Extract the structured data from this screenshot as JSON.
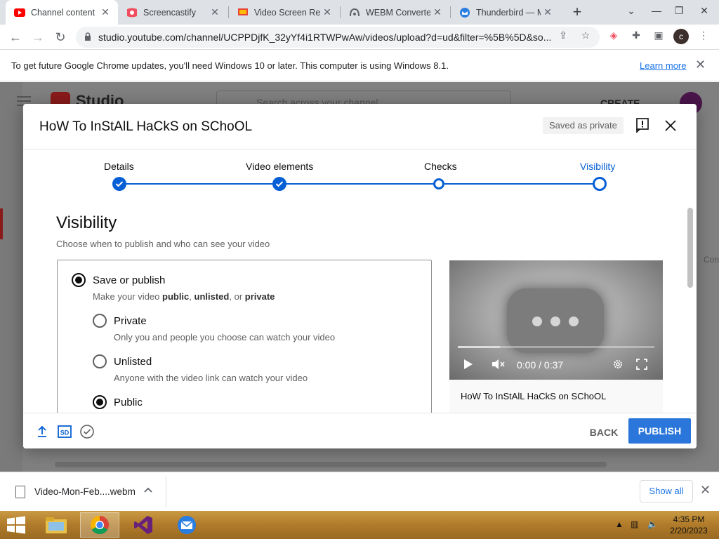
{
  "browser": {
    "tabs": [
      {
        "title": "Channel content",
        "icon": "youtube-icon",
        "active": true
      },
      {
        "title": "Screencastify",
        "icon": "screencastify-icon",
        "active": false
      },
      {
        "title": "Video Screen Rec",
        "icon": "screen-recorder-icon",
        "active": false
      },
      {
        "title": "WEBM Converter",
        "icon": "converter-icon",
        "active": false
      },
      {
        "title": "Thunderbird — M",
        "icon": "thunderbird-icon",
        "active": false
      }
    ],
    "url": "studio.youtube.com/channel/UCPPDjfK_32yYf4i1RTWPwAw/videos/upload?d=ud&filter=%5B%5D&so...",
    "profile_initial": "c"
  },
  "infobar": {
    "message": "To get future Google Chrome updates, you'll need Windows 10 or later. This computer is using Windows 8.1.",
    "link": "Learn more"
  },
  "background_page": {
    "logo_text": "Studio",
    "search_placeholder": "Search across your channel",
    "create_label": "CREATE",
    "side_text": "Con"
  },
  "dialog": {
    "title": "HoW To InStAlL HaCkS on SChoOL",
    "saved_badge": "Saved as private",
    "steps": [
      {
        "label": "Details",
        "state": "done"
      },
      {
        "label": "Video elements",
        "state": "done"
      },
      {
        "label": "Checks",
        "state": "reached"
      },
      {
        "label": "Visibility",
        "state": "current"
      }
    ],
    "visibility_heading": "Visibility",
    "visibility_subtitle": "Choose when to publish and who can see your video",
    "save_publish": {
      "label": "Save or publish",
      "desc_prefix": "Make your video ",
      "desc_public": "public",
      "desc_sep1": ", ",
      "desc_unlisted": "unlisted",
      "desc_sep2": ", or ",
      "desc_private": "private",
      "selected": true
    },
    "options": [
      {
        "label": "Private",
        "desc": "Only you and people you choose can watch your video",
        "selected": false
      },
      {
        "label": "Unlisted",
        "desc": "Anyone with the video link can watch your video",
        "selected": false
      },
      {
        "label": "Public",
        "desc": "",
        "selected": true
      }
    ],
    "preview": {
      "time": "0:00 / 0:37",
      "title": "HoW To InStAlL HaCkS on SChoOL"
    },
    "back_label": "BACK",
    "publish_label": "PUBLISH",
    "accent": "#065fd4"
  },
  "downloads": {
    "file_name": "Video-Mon-Feb....webm",
    "show_all": "Show all"
  },
  "taskbar": {
    "time": "4:35 PM",
    "date": "2/20/2023"
  }
}
